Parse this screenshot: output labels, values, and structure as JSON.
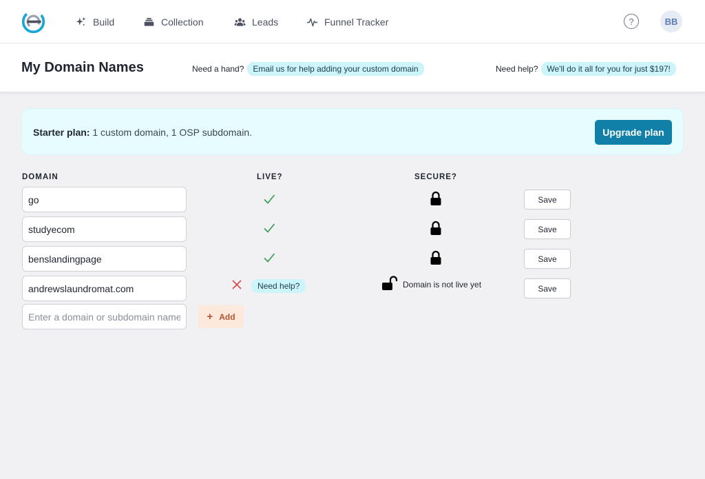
{
  "nav": {
    "items": [
      {
        "label": "Build",
        "icon": "sparkles-icon"
      },
      {
        "label": "Collection",
        "icon": "stack-icon"
      },
      {
        "label": "Leads",
        "icon": "users-icon"
      },
      {
        "label": "Funnel Tracker",
        "icon": "pulse-icon"
      }
    ],
    "help_symbol": "?",
    "avatar_initials": "BB"
  },
  "header": {
    "title": "My Domain Names",
    "hand_prompt": "Need a hand?",
    "hand_link": "Email us for help adding your custom domain",
    "help_prompt": "Need help?",
    "help_link": "We'll do it all for you for just $197!"
  },
  "plan": {
    "label": "Starter plan:",
    "description": " 1 custom domain, 1 OSP subdomain.",
    "upgrade_label": "Upgrade plan"
  },
  "table": {
    "headers": {
      "domain": "DOMAIN",
      "live": "LIVE?",
      "secure": "SECURE?"
    },
    "rows": [
      {
        "domain": "go",
        "live": true,
        "secure": true,
        "save_label": "Save"
      },
      {
        "domain": "studyecom",
        "live": true,
        "secure": true,
        "save_label": "Save"
      },
      {
        "domain": "benslandingpage",
        "live": true,
        "secure": true,
        "save_label": "Save"
      },
      {
        "domain": "andrewslaundromat.com",
        "live": false,
        "secure": false,
        "live_help_label": "Need help?",
        "secure_status": "Domain is not live yet",
        "save_label": "Save"
      }
    ]
  },
  "new_domain": {
    "placeholder": "Enter a domain or subdomain name",
    "add_label": "Add",
    "add_symbol": "+"
  },
  "colors": {
    "accent": "#1080a8",
    "pill_bg": "#ccf5fa",
    "banner_bg": "#e6fcfe",
    "check_green": "#2e9e4f",
    "x_red": "#d64545",
    "add_bg": "#fde9dc"
  }
}
